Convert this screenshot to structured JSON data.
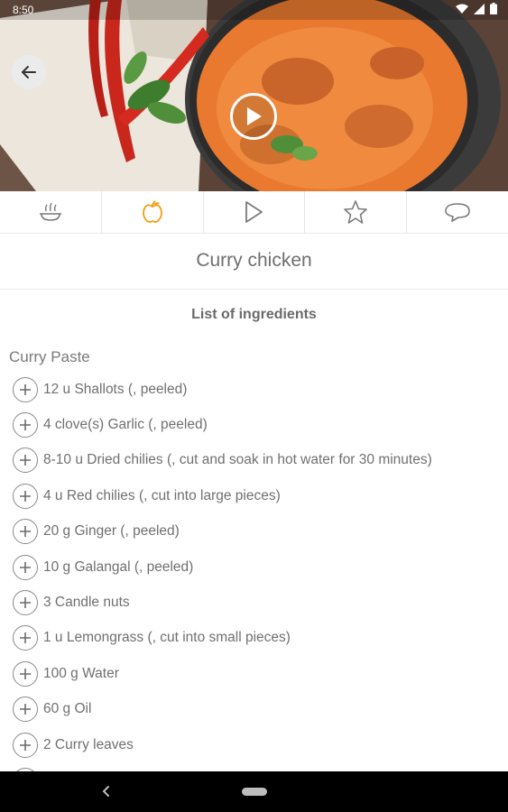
{
  "status": {
    "time": "8:50"
  },
  "recipe": {
    "title": "Curry chicken"
  },
  "tabs": [
    {
      "icon": "cooking-pot-icon"
    },
    {
      "icon": "apple-icon",
      "active": true
    },
    {
      "icon": "play-icon"
    },
    {
      "icon": "star-icon"
    },
    {
      "icon": "comment-icon"
    }
  ],
  "section": {
    "heading": "List of ingredients",
    "group": "Curry Paste"
  },
  "ingredients": [
    "12 u Shallots (, peeled)",
    "4 clove(s) Garlic (, peeled)",
    "8-10 u Dried chilies (, cut and soak in hot water for 30 minutes)",
    "4 u Red chilies (, cut into large pieces)",
    "20 g Ginger (, peeled)",
    "10 g Galangal (, peeled)",
    "3 Candle nuts",
    "1 u Lemongrass (, cut into small pieces)",
    "100 g Water",
    "60 g Oil",
    "2 Curry leaves"
  ],
  "colors": {
    "accent": "#f39c12",
    "icon_gray": "#7a7a7a",
    "text": "#707070"
  }
}
